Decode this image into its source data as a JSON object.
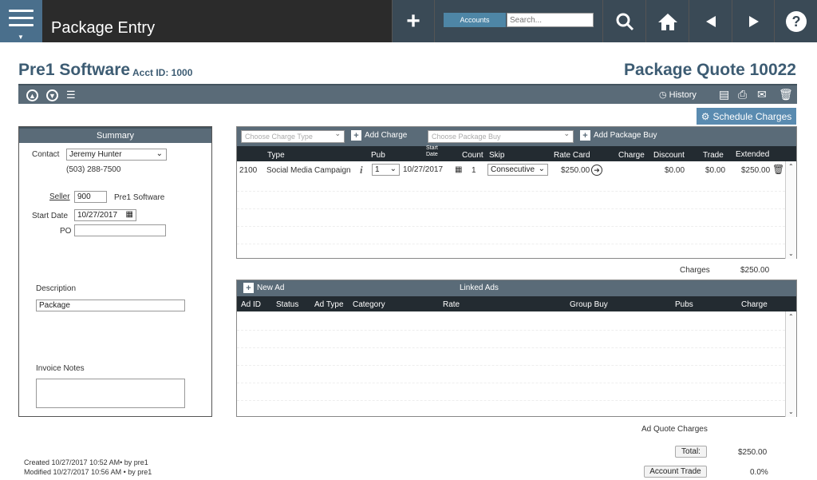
{
  "header": {
    "app_title": "Package Entry",
    "accounts_label": "Accounts",
    "search_placeholder": "Search..."
  },
  "page": {
    "company": "Pre1 Software",
    "acct_id": "Acct ID: 1000",
    "quote_title": "Package Quote 10022"
  },
  "toolbar": {
    "history_label": "History",
    "schedule_label": "Schedule Charges"
  },
  "summary": {
    "title": "Summary",
    "contact_label": "Contact",
    "contact_value": "Jeremy Hunter",
    "phone": "(503) 288-7500",
    "seller_label": "Seller",
    "seller_value": "900",
    "seller_name": "Pre1 Software",
    "start_label": "Start Date",
    "start_value": "10/27/2017",
    "po_label": "PO",
    "po_value": "",
    "description_label": "Description",
    "description_value": "Package",
    "invoice_label": "Invoice Notes",
    "invoice_value": ""
  },
  "charges": {
    "charge_type_placeholder": "Choose Charge Type",
    "add_charge_label": "Add Charge",
    "package_buy_placeholder": "Choose Package Buy",
    "add_package_label": "Add Package Buy",
    "columns": {
      "type": "Type",
      "pub": "Pub",
      "start_date_1": "Start",
      "start_date_2": "Date",
      "count": "Count",
      "skip": "Skip",
      "rate_card": "Rate Card",
      "charge": "Charge",
      "discount": "Discount",
      "trade": "Trade",
      "extended": "Extended"
    },
    "row": {
      "code": "2100",
      "type": "Social Media Campaign",
      "info": "i",
      "pub": "1",
      "start": "10/27/2017",
      "count": "1",
      "skip": "Consecutive",
      "rate_card": "$250.00",
      "discount": "$0.00",
      "trade": "$0.00",
      "extended": "$250.00"
    },
    "charges_label": "Charges",
    "charges_value": "$250.00"
  },
  "linked": {
    "new_ad_label": "New Ad",
    "title": "Linked Ads",
    "columns": {
      "ad_id": "Ad ID",
      "status": "Status",
      "ad_type": "Ad Type",
      "category": "Category",
      "rate": "Rate",
      "group_buy": "Group Buy",
      "pubs": "Pubs",
      "charge": "Charge"
    }
  },
  "totals": {
    "ad_quote_label": "Ad Quote Charges",
    "total_label": "Total:",
    "total_value": "$250.00",
    "account_trade_label": "Account Trade",
    "account_trade_value": "0.0%"
  },
  "meta": {
    "created": "Created 10/27/2017 10:52 AM• by pre1",
    "modified": "Modified 10/27/2017 10:56 AM • by pre1"
  }
}
